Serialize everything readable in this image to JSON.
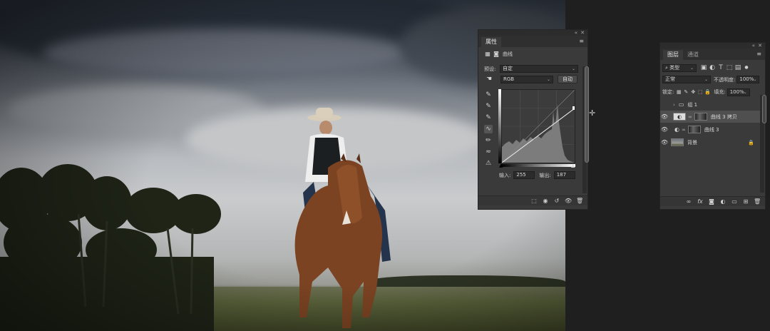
{
  "properties_panel": {
    "tab_label": "属性",
    "section_title": "曲线",
    "preset_label": "预设:",
    "preset_value": "自定",
    "channel_value": "RGB",
    "auto_button": "自动",
    "input_label": "输入:",
    "input_value": "255",
    "output_label": "输出:",
    "output_value": "187"
  },
  "layers_panel": {
    "tabs": [
      {
        "label": "图层"
      },
      {
        "label": "通道"
      }
    ],
    "filter_value": "类型",
    "blend_mode_value": "正常",
    "opacity_label": "不透明度:",
    "opacity_value": "100%",
    "lock_label": "锁定:",
    "fill_label": "填充:",
    "fill_value": "100%",
    "layers": [
      {
        "name": "组 1"
      },
      {
        "name": "曲线 3 拷贝"
      },
      {
        "name": "曲线 3"
      },
      {
        "name": "背景"
      }
    ]
  },
  "icons": {
    "eye": "eye-icon",
    "folder": "folder-icon",
    "lock": "lock-icon",
    "curve_tool": "curve-tool-icon",
    "eyedropper": "eyedropper-icon",
    "pencil": "pencil-icon",
    "crosshair": "crosshair-icon"
  },
  "colors": {
    "panel_bg": "#3a3a3a",
    "panel_dark": "#2b2b2b",
    "selected_row": "#4f4f4f",
    "app_bg": "#1e1e1e"
  }
}
